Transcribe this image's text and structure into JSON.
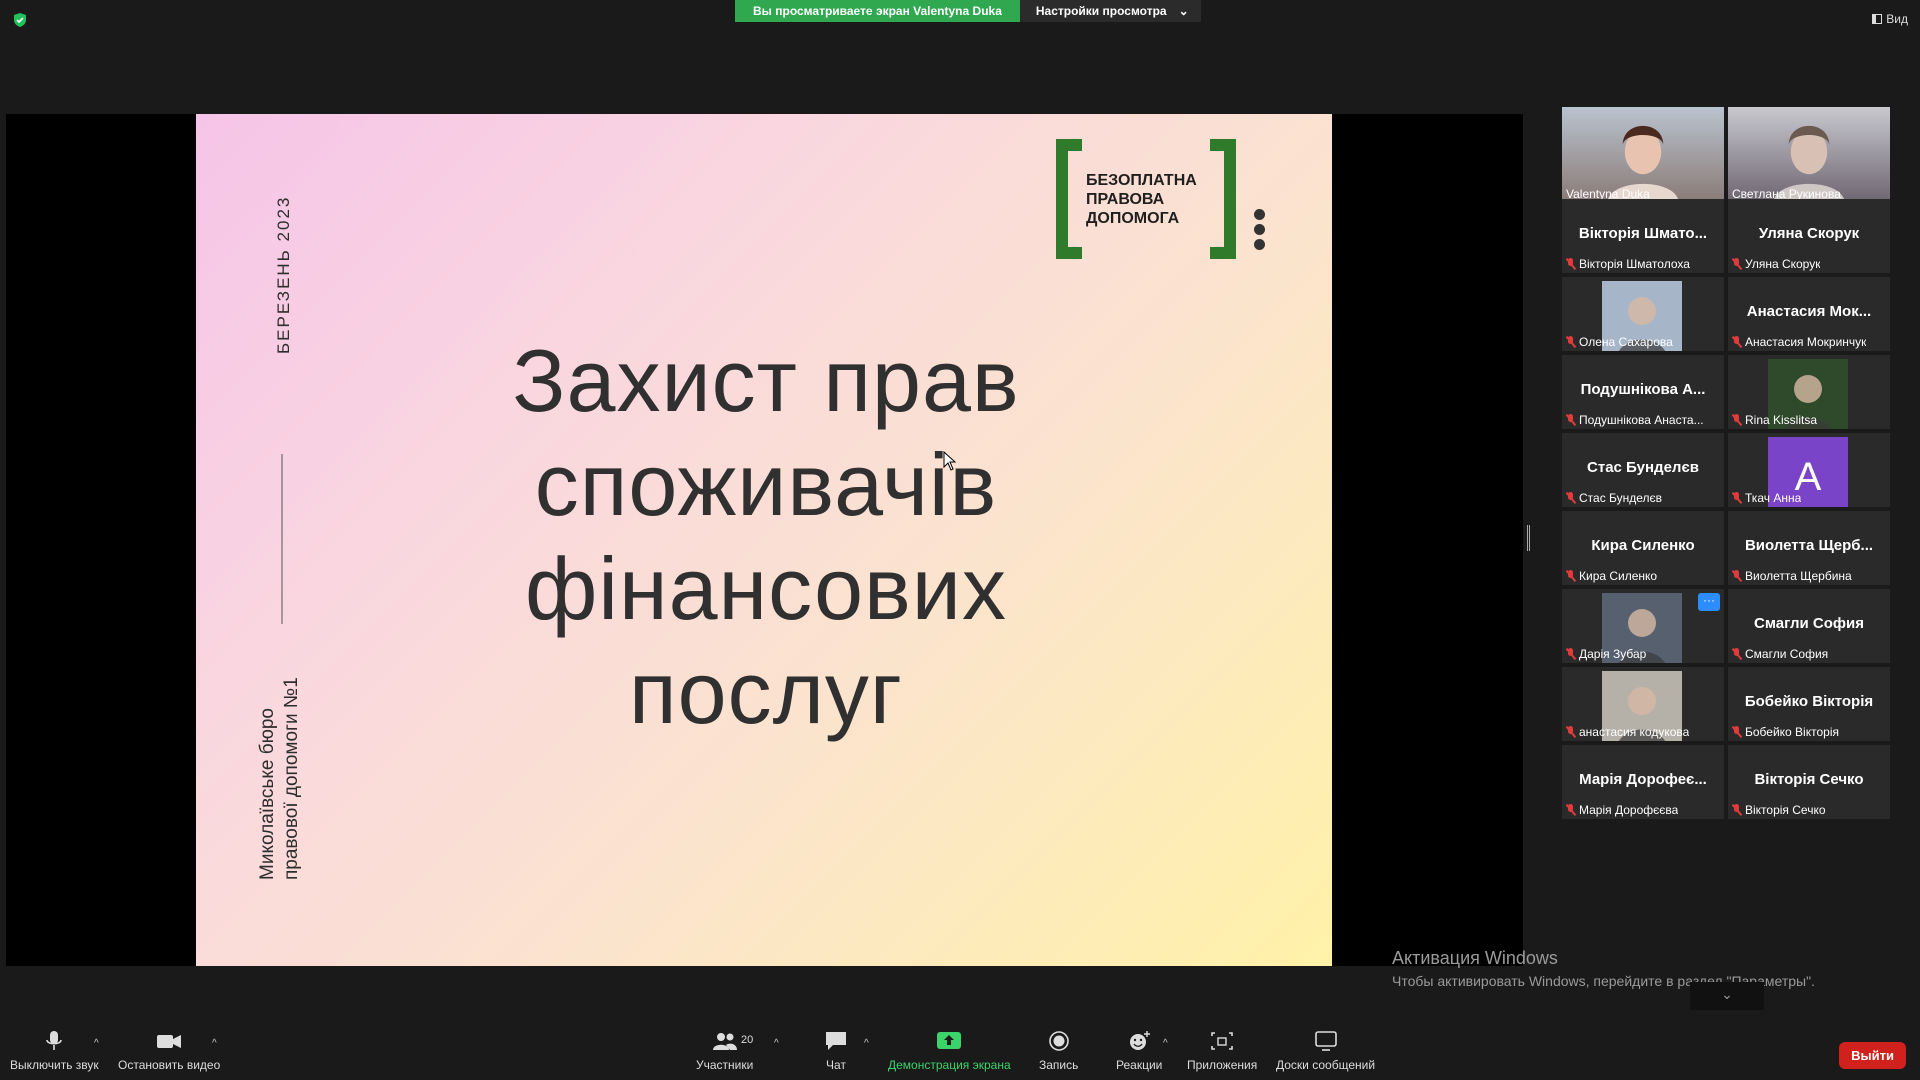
{
  "banner": {
    "viewing_text": "Вы просматриваете экран Valentyna Duka",
    "settings_label": "Настройки просмотра",
    "view_label": "Вид"
  },
  "slide": {
    "date": "БЕРЕЗЕНЬ 2023",
    "bureau": "Миколаївське бюро правової допомоги №1",
    "title": "Захист прав споживачів фінансових послуг",
    "logo": "БЕЗОПЛАТНА ПРАВОВА ДОПОМОГА"
  },
  "participants": [
    {
      "big": "",
      "name": "Valentyna Duka",
      "video": true,
      "active": true,
      "muted": false
    },
    {
      "big": "",
      "name": "Светлана Рукинова",
      "video": true,
      "active": false,
      "muted": false
    },
    {
      "big": "Вікторія Шмато...",
      "name": "Вікторія Шматолоха",
      "muted": true
    },
    {
      "big": "Уляна Скорук",
      "name": "Уляна Скорук",
      "muted": true
    },
    {
      "big": "",
      "name": "Олена Сахарова",
      "photo": true,
      "muted": true
    },
    {
      "big": "Анастасия Мок...",
      "name": "Анастасия Мокринчук",
      "muted": true
    },
    {
      "big": "Подушнікова А...",
      "name": "Подушнікова Анаста...",
      "muted": true
    },
    {
      "big": "",
      "name": "Rina Kisslitsa",
      "photo": true,
      "muted": true
    },
    {
      "big": "Стас Бунделєв",
      "name": "Стас Бунделєв",
      "muted": true
    },
    {
      "big": "",
      "name": "Ткач Анна",
      "avatar": "A",
      "muted": true
    },
    {
      "big": "Кира Силенко",
      "name": "Кира Силенко",
      "muted": true
    },
    {
      "big": "Виолетта Щерб...",
      "name": "Виолетта Щербина",
      "muted": true
    },
    {
      "big": "",
      "name": "Дарія Зубар",
      "photo": true,
      "muted": true
    },
    {
      "big": "Смагли София",
      "name": "Смагли София",
      "muted": true
    },
    {
      "big": "",
      "name": "анастасия кодукова",
      "photo": true,
      "muted": true
    },
    {
      "big": "Бобейко Вікторія",
      "name": "Бобейко Вікторія",
      "muted": true
    },
    {
      "big": "Марія Дорофеє...",
      "name": "Марія Дорофєєва",
      "muted": true
    },
    {
      "big": "Вікторія Сечко",
      "name": "Вікторія Сечко",
      "muted": true
    }
  ],
  "windows": {
    "line1": "Активация Windows",
    "line2": "Чтобы активировать Windows, перейдите в раздел \"Параметры\"."
  },
  "toolbar": {
    "mute": "Выключить звук",
    "video": "Остановить видео",
    "participants": "Участники",
    "participants_count": "20",
    "chat": "Чат",
    "share": "Демонстрация экрана",
    "record": "Запись",
    "reactions": "Реакции",
    "apps": "Приложения",
    "whiteboards": "Доски сообщений",
    "leave": "Выйти",
    "more_label": "···"
  },
  "colors": {
    "banner_green": "#2fa84f",
    "leave_red": "#d0211c",
    "active_speaker": "#d7e534",
    "logo_green": "#2f7a2b"
  }
}
